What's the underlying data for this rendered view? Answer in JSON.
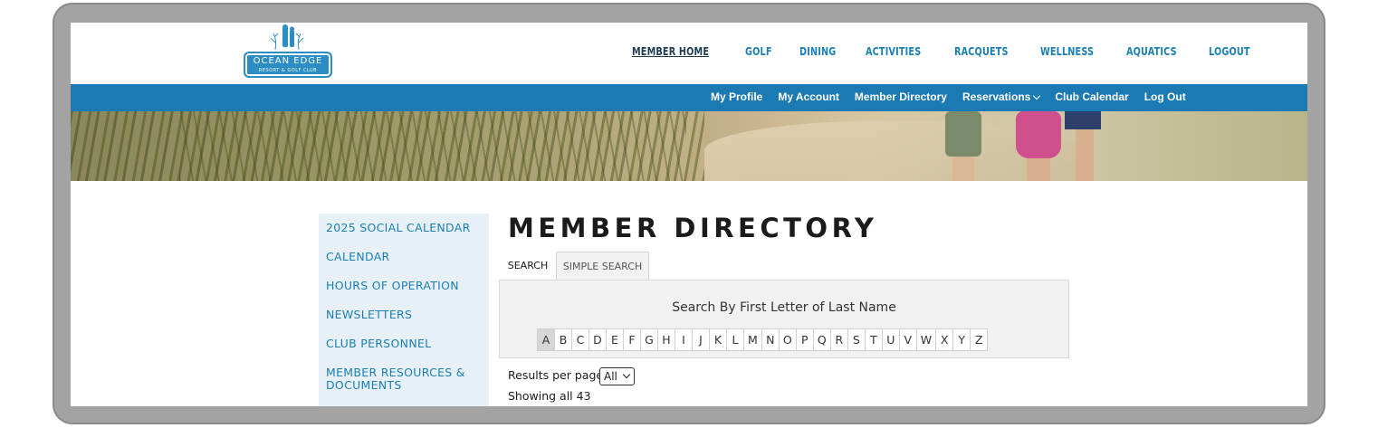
{
  "brand": {
    "logo_title": "OCEAN EDGE",
    "logo_subtitle": "RESORT & GOLF CLUB",
    "accent_color": "#1b7ab4"
  },
  "main_nav": [
    {
      "label": "MEMBER HOME",
      "active": true
    },
    {
      "label": "GOLF"
    },
    {
      "label": "DINING"
    },
    {
      "label": "ACTIVITIES"
    },
    {
      "label": "RACQUETS"
    },
    {
      "label": "WELLNESS"
    },
    {
      "label": "AQUATICS"
    },
    {
      "label": "LOGOUT"
    }
  ],
  "sub_nav": [
    {
      "label": "My Profile"
    },
    {
      "label": "My Account"
    },
    {
      "label": "Member Directory"
    },
    {
      "label": "Reservations",
      "icon": "chevron-down-icon"
    },
    {
      "label": "Club Calendar"
    },
    {
      "label": "Log Out"
    }
  ],
  "sidebar": {
    "items": [
      {
        "label": "2025 SOCIAL CALENDAR"
      },
      {
        "label": "CALENDAR"
      },
      {
        "label": "HOURS OF OPERATION"
      },
      {
        "label": "NEWSLETTERS"
      },
      {
        "label": "CLUB PERSONNEL"
      },
      {
        "label": "MEMBER RESOURCES &"
      },
      {
        "label": "DOCUMENTS"
      }
    ]
  },
  "page": {
    "title": "MEMBER DIRECTORY",
    "tabs": [
      {
        "label": "SEARCH"
      },
      {
        "label": "SIMPLE SEARCH",
        "selected": true
      }
    ],
    "search_heading": "Search By First Letter of Last Name",
    "letters": [
      "A",
      "B",
      "C",
      "D",
      "E",
      "F",
      "G",
      "H",
      "I",
      "J",
      "K",
      "L",
      "M",
      "N",
      "O",
      "P",
      "Q",
      "R",
      "S",
      "T",
      "U",
      "V",
      "W",
      "X",
      "Y",
      "Z"
    ],
    "selected_letter": "A",
    "results_per_page_label": "Results per page:",
    "results_per_page_value": "All",
    "showing_text": "Showing all 43"
  }
}
